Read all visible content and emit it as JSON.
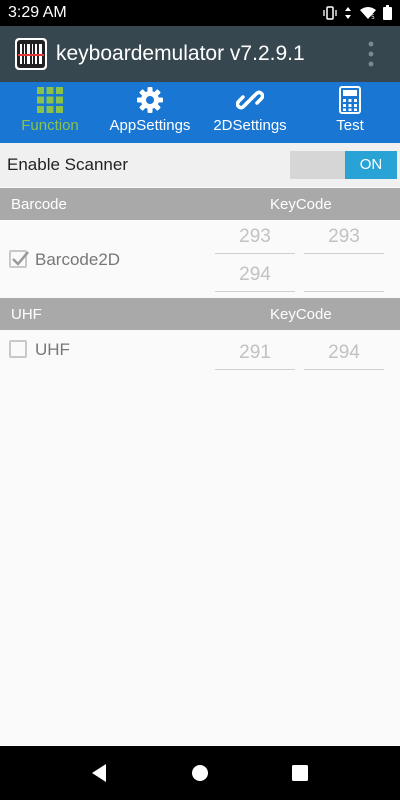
{
  "status_bar": {
    "time": "3:29 AM",
    "icons": [
      "vibrate-icon",
      "data-arrows-icon",
      "wifi-icon",
      "battery-icon"
    ]
  },
  "app_bar": {
    "title": "keyboardemulator v7.2.9.1",
    "logo_icon": "barcode-scanner-icon",
    "menu_icon": "overflow-menu-icon"
  },
  "tabs": [
    {
      "label": "Function",
      "icon": "grid-icon",
      "active": true
    },
    {
      "label": "AppSettings",
      "icon": "gear-icon",
      "active": false
    },
    {
      "label": "2DSettings",
      "icon": "link-icon",
      "active": false
    },
    {
      "label": "Test",
      "icon": "calculator-icon",
      "active": false
    }
  ],
  "enable_scanner": {
    "label": "Enable Scanner",
    "state": "ON"
  },
  "sections": [
    {
      "header": "Barcode",
      "keycode_header": "KeyCode",
      "item": {
        "label": "Barcode2D",
        "checked": true,
        "keycodes": [
          "293",
          "293",
          "294",
          ""
        ]
      }
    },
    {
      "header": "UHF",
      "keycode_header": "KeyCode",
      "item": {
        "label": "UHF",
        "checked": false,
        "keycodes": [
          "291",
          "294"
        ]
      }
    }
  ],
  "colors": {
    "app_bar": "#37474f",
    "tab_bar": "#1976d2",
    "active_tab": "#8bc34a",
    "toggle_on": "#29a3d6",
    "section_header": "#a9a9a9"
  }
}
